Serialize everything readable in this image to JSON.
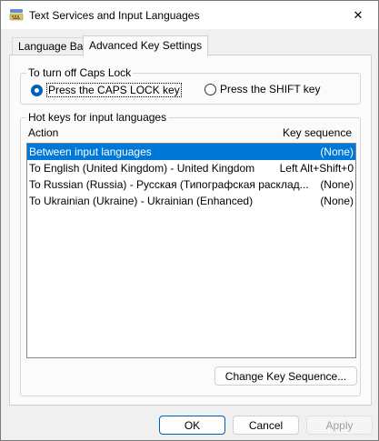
{
  "window": {
    "title": "Text Services and Input Languages",
    "close_symbol": "✕"
  },
  "tabs": [
    {
      "label": "Language Bar",
      "active": false
    },
    {
      "label": "Advanced Key Settings",
      "active": true
    }
  ],
  "caps_lock": {
    "group_label": "To turn off Caps Lock",
    "options": [
      {
        "label": "Press the CAPS LOCK key",
        "selected": true
      },
      {
        "label": "Press the SHIFT key",
        "selected": false
      }
    ]
  },
  "hotkeys": {
    "group_label": "Hot keys for input languages",
    "columns": {
      "action": "Action",
      "sequence": "Key sequence"
    },
    "rows": [
      {
        "action": "Between input languages",
        "sequence": "(None)",
        "selected": true
      },
      {
        "action": "To English (United Kingdom) - United Kingdom",
        "sequence": "Left Alt+Shift+0",
        "selected": false
      },
      {
        "action": "To Russian (Russia) - Русская (Типографская расклад...",
        "sequence": "(None)",
        "selected": false
      },
      {
        "action": "To Ukrainian (Ukraine) - Ukrainian (Enhanced)",
        "sequence": "(None)",
        "selected": false
      }
    ],
    "change_button": "Change Key Sequence..."
  },
  "footer": {
    "ok": "OK",
    "cancel": "Cancel",
    "apply": "Apply"
  },
  "colors": {
    "accent": "#0078d7",
    "selection_text": "#ffffff",
    "disabled_text": "#a0a0a0"
  }
}
